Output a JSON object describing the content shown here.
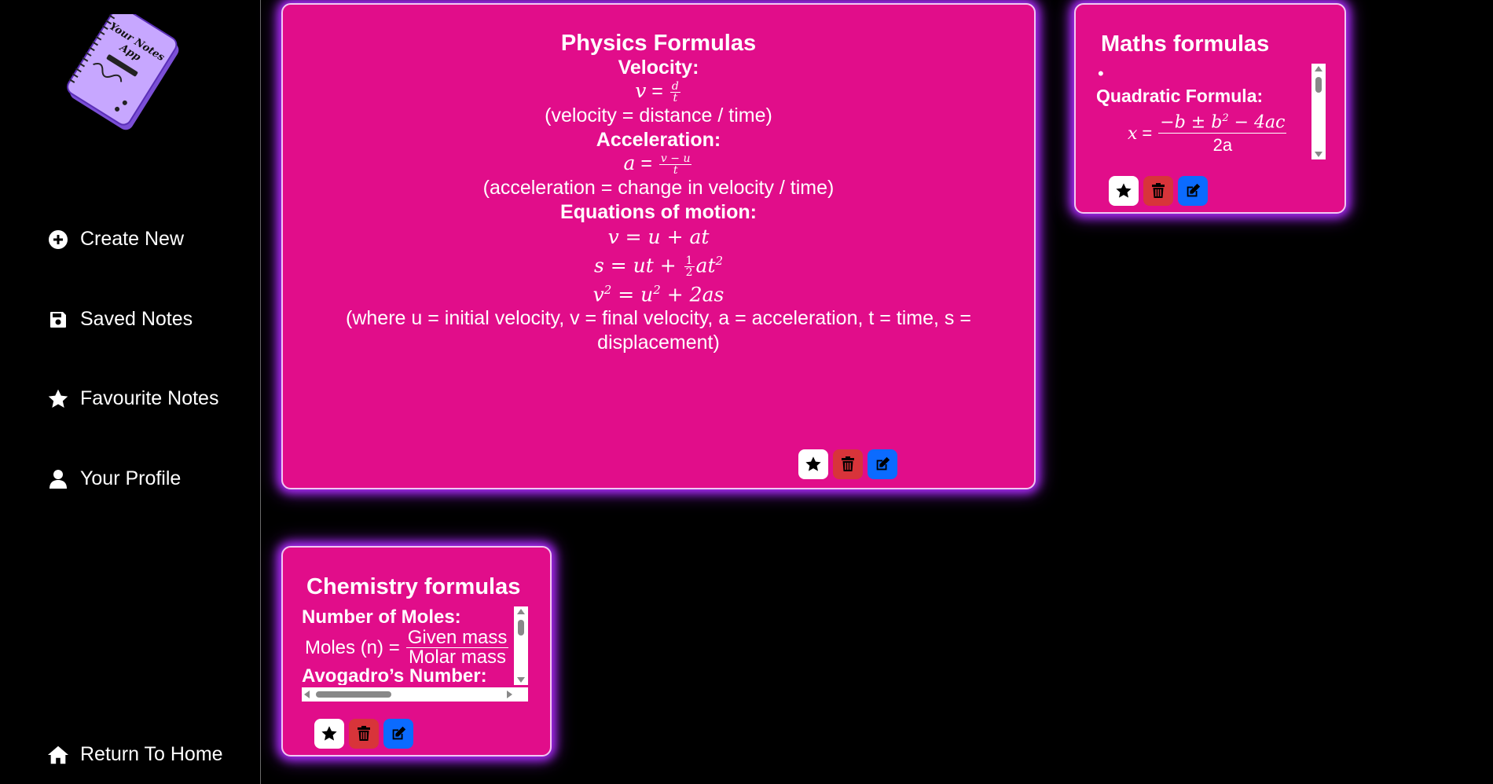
{
  "logo": {
    "text_line1": "Your Notes",
    "text_line2": "App"
  },
  "nav": {
    "create_new": "Create New",
    "saved_notes": "Saved Notes",
    "favourite_notes": "Favourite Notes",
    "your_profile": "Your Profile",
    "return_home": "Return To Home"
  },
  "physics": {
    "title": "Physics Formulas",
    "velocity_heading": "Velocity:",
    "velocity_desc": "(velocity = distance / time)",
    "acceleration_heading": "Acceleration:",
    "acceleration_desc": "(acceleration = change in velocity / time)",
    "equations_heading": "Equations of motion:",
    "where_line1": "(where u = initial velocity, v = final velocity, a = acceleration, t = time, s =",
    "where_line2": "displacement)"
  },
  "maths": {
    "title": "Maths formulas",
    "bullet": "•",
    "quadratic_heading": "Quadratic Formula:",
    "denominator": "2a"
  },
  "chemistry": {
    "title": "Chemistry formulas",
    "moles_heading": "Number of Moles:",
    "moles_lhs": "Moles (n) =",
    "moles_num": "Given mass",
    "moles_den": "Molar mass",
    "avogadro_heading": "Avogadro’s Number:"
  },
  "colors": {
    "card_bg": "#e10d8a",
    "glow": "#b02cff",
    "star_btn": "#ffffff",
    "delete_btn": "#d8343a",
    "edit_btn": "#0b6bff"
  },
  "icons": [
    "plus-circle-icon",
    "floppy-disk-icon",
    "star-icon",
    "user-icon",
    "home-icon",
    "trash-icon",
    "edit-icon"
  ]
}
